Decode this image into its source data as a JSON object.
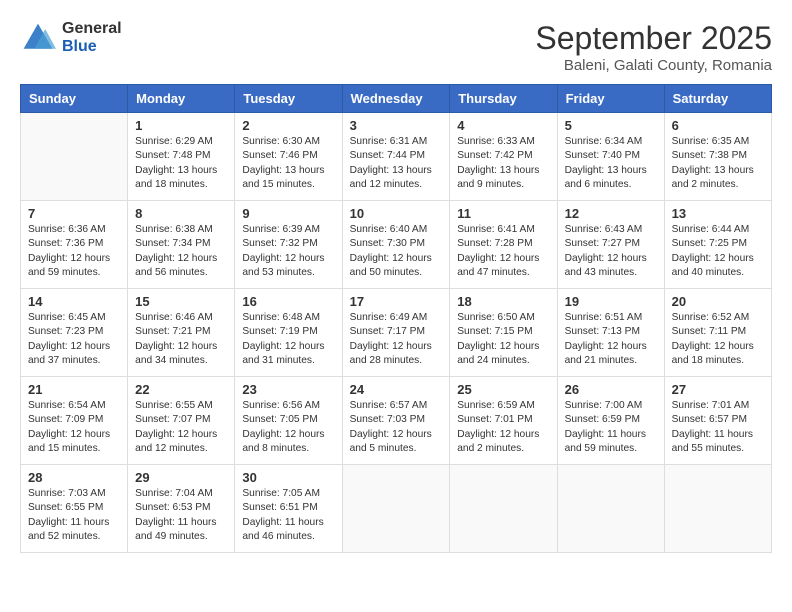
{
  "header": {
    "logo_general": "General",
    "logo_blue": "Blue",
    "month": "September 2025",
    "location": "Baleni, Galati County, Romania"
  },
  "weekdays": [
    "Sunday",
    "Monday",
    "Tuesday",
    "Wednesday",
    "Thursday",
    "Friday",
    "Saturday"
  ],
  "weeks": [
    [
      {
        "day": "",
        "info": ""
      },
      {
        "day": "1",
        "info": "Sunrise: 6:29 AM\nSunset: 7:48 PM\nDaylight: 13 hours\nand 18 minutes."
      },
      {
        "day": "2",
        "info": "Sunrise: 6:30 AM\nSunset: 7:46 PM\nDaylight: 13 hours\nand 15 minutes."
      },
      {
        "day": "3",
        "info": "Sunrise: 6:31 AM\nSunset: 7:44 PM\nDaylight: 13 hours\nand 12 minutes."
      },
      {
        "day": "4",
        "info": "Sunrise: 6:33 AM\nSunset: 7:42 PM\nDaylight: 13 hours\nand 9 minutes."
      },
      {
        "day": "5",
        "info": "Sunrise: 6:34 AM\nSunset: 7:40 PM\nDaylight: 13 hours\nand 6 minutes."
      },
      {
        "day": "6",
        "info": "Sunrise: 6:35 AM\nSunset: 7:38 PM\nDaylight: 13 hours\nand 2 minutes."
      }
    ],
    [
      {
        "day": "7",
        "info": "Sunrise: 6:36 AM\nSunset: 7:36 PM\nDaylight: 12 hours\nand 59 minutes."
      },
      {
        "day": "8",
        "info": "Sunrise: 6:38 AM\nSunset: 7:34 PM\nDaylight: 12 hours\nand 56 minutes."
      },
      {
        "day": "9",
        "info": "Sunrise: 6:39 AM\nSunset: 7:32 PM\nDaylight: 12 hours\nand 53 minutes."
      },
      {
        "day": "10",
        "info": "Sunrise: 6:40 AM\nSunset: 7:30 PM\nDaylight: 12 hours\nand 50 minutes."
      },
      {
        "day": "11",
        "info": "Sunrise: 6:41 AM\nSunset: 7:28 PM\nDaylight: 12 hours\nand 47 minutes."
      },
      {
        "day": "12",
        "info": "Sunrise: 6:43 AM\nSunset: 7:27 PM\nDaylight: 12 hours\nand 43 minutes."
      },
      {
        "day": "13",
        "info": "Sunrise: 6:44 AM\nSunset: 7:25 PM\nDaylight: 12 hours\nand 40 minutes."
      }
    ],
    [
      {
        "day": "14",
        "info": "Sunrise: 6:45 AM\nSunset: 7:23 PM\nDaylight: 12 hours\nand 37 minutes."
      },
      {
        "day": "15",
        "info": "Sunrise: 6:46 AM\nSunset: 7:21 PM\nDaylight: 12 hours\nand 34 minutes."
      },
      {
        "day": "16",
        "info": "Sunrise: 6:48 AM\nSunset: 7:19 PM\nDaylight: 12 hours\nand 31 minutes."
      },
      {
        "day": "17",
        "info": "Sunrise: 6:49 AM\nSunset: 7:17 PM\nDaylight: 12 hours\nand 28 minutes."
      },
      {
        "day": "18",
        "info": "Sunrise: 6:50 AM\nSunset: 7:15 PM\nDaylight: 12 hours\nand 24 minutes."
      },
      {
        "day": "19",
        "info": "Sunrise: 6:51 AM\nSunset: 7:13 PM\nDaylight: 12 hours\nand 21 minutes."
      },
      {
        "day": "20",
        "info": "Sunrise: 6:52 AM\nSunset: 7:11 PM\nDaylight: 12 hours\nand 18 minutes."
      }
    ],
    [
      {
        "day": "21",
        "info": "Sunrise: 6:54 AM\nSunset: 7:09 PM\nDaylight: 12 hours\nand 15 minutes."
      },
      {
        "day": "22",
        "info": "Sunrise: 6:55 AM\nSunset: 7:07 PM\nDaylight: 12 hours\nand 12 minutes."
      },
      {
        "day": "23",
        "info": "Sunrise: 6:56 AM\nSunset: 7:05 PM\nDaylight: 12 hours\nand 8 minutes."
      },
      {
        "day": "24",
        "info": "Sunrise: 6:57 AM\nSunset: 7:03 PM\nDaylight: 12 hours\nand 5 minutes."
      },
      {
        "day": "25",
        "info": "Sunrise: 6:59 AM\nSunset: 7:01 PM\nDaylight: 12 hours\nand 2 minutes."
      },
      {
        "day": "26",
        "info": "Sunrise: 7:00 AM\nSunset: 6:59 PM\nDaylight: 11 hours\nand 59 minutes."
      },
      {
        "day": "27",
        "info": "Sunrise: 7:01 AM\nSunset: 6:57 PM\nDaylight: 11 hours\nand 55 minutes."
      }
    ],
    [
      {
        "day": "28",
        "info": "Sunrise: 7:03 AM\nSunset: 6:55 PM\nDaylight: 11 hours\nand 52 minutes."
      },
      {
        "day": "29",
        "info": "Sunrise: 7:04 AM\nSunset: 6:53 PM\nDaylight: 11 hours\nand 49 minutes."
      },
      {
        "day": "30",
        "info": "Sunrise: 7:05 AM\nSunset: 6:51 PM\nDaylight: 11 hours\nand 46 minutes."
      },
      {
        "day": "",
        "info": ""
      },
      {
        "day": "",
        "info": ""
      },
      {
        "day": "",
        "info": ""
      },
      {
        "day": "",
        "info": ""
      }
    ]
  ]
}
